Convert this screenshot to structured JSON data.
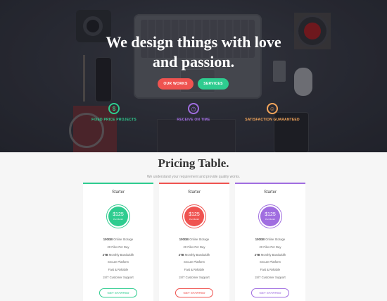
{
  "hero": {
    "title_line1": "We design things with love",
    "title_line2": "and passion.",
    "buttons": {
      "works": "OUR WORKS",
      "services": "SERVICES"
    },
    "features": [
      {
        "label": "FIXED PRICE PROJECTS",
        "icon": "dollar-icon",
        "glyph": "$",
        "color": "#2ecc8f"
      },
      {
        "label": "RECEIVE ON TIME",
        "icon": "clock-icon",
        "glyph": "◷",
        "color": "#a06de0"
      },
      {
        "label": "SATISFACTION GUARANTEED",
        "icon": "smile-icon",
        "glyph": "☺",
        "color": "#f5a65b"
      }
    ]
  },
  "pricing": {
    "title": "Pricing Table.",
    "subtitle": "We understand your requirement and provide quality works.",
    "plans": [
      {
        "name": "Starter",
        "price": "$125",
        "period": "Per Month",
        "color": "#2ecc8f",
        "features": [
          {
            "bold": "100GB",
            "text": " Online Storage"
          },
          {
            "bold": "",
            "text": "20 Files Per Day"
          },
          {
            "bold": "2TB",
            "text": " Monthly Bandwidth"
          },
          {
            "bold": "",
            "text": "Secure Platform"
          },
          {
            "bold": "",
            "text": "Fast & Reliable"
          },
          {
            "bold": "",
            "text": "24/7 Customer Support"
          }
        ],
        "cta": "GET STARTED"
      },
      {
        "name": "Starter",
        "price": "$125",
        "period": "Per Month",
        "color": "#ef5350",
        "features": [
          {
            "bold": "100GB",
            "text": " Online Storage"
          },
          {
            "bold": "",
            "text": "20 Files Per Day"
          },
          {
            "bold": "2TB",
            "text": " Monthly Bandwidth"
          },
          {
            "bold": "",
            "text": "Secure Platform"
          },
          {
            "bold": "",
            "text": "Fast & Reliable"
          },
          {
            "bold": "",
            "text": "24/7 Customer Support"
          }
        ],
        "cta": "GET STARTED"
      },
      {
        "name": "Starter",
        "price": "$125",
        "period": "Per Month",
        "color": "#a06de0",
        "features": [
          {
            "bold": "100GB",
            "text": " Online Storage"
          },
          {
            "bold": "",
            "text": "20 Files Per Day"
          },
          {
            "bold": "2TB",
            "text": " Monthly Bandwidth"
          },
          {
            "bold": "",
            "text": "Secure Platform"
          },
          {
            "bold": "",
            "text": "Fast & Reliable"
          },
          {
            "bold": "",
            "text": "24/7 Customer Support"
          }
        ],
        "cta": "GET STARTED"
      }
    ]
  }
}
